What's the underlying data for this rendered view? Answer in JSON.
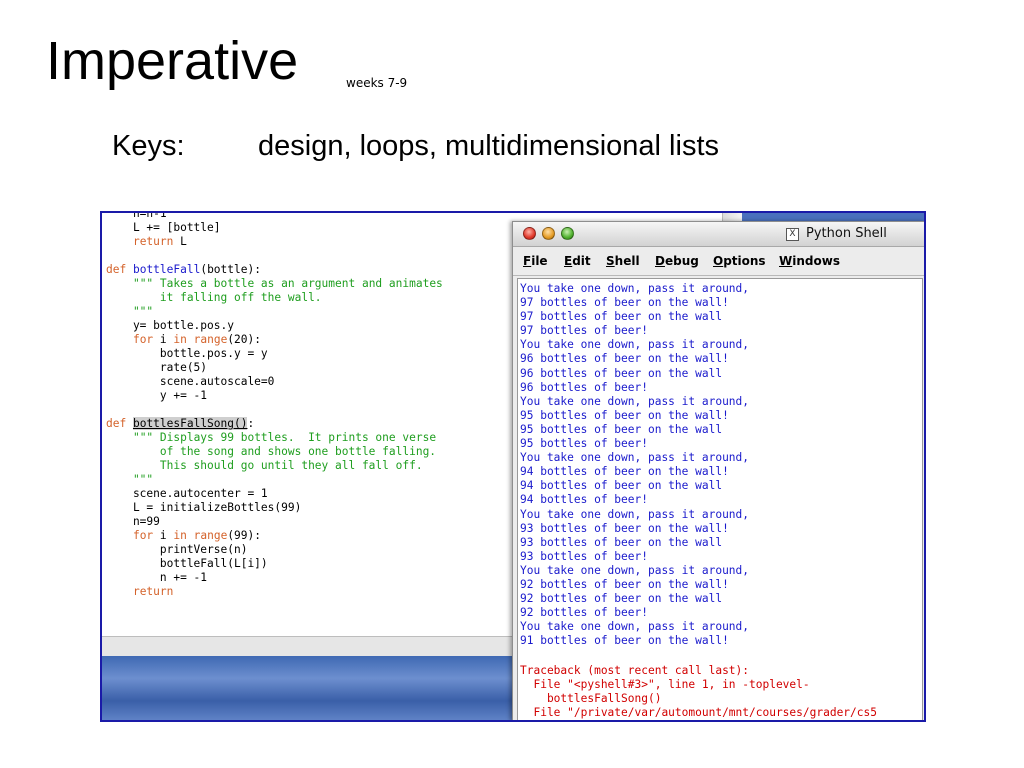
{
  "slide": {
    "title": "Imperative",
    "subtitle": "weeks 7-9",
    "keys_label": "Keys:",
    "keys_value": "design, loops, multidimensional lists"
  },
  "editor": {
    "code_lines": [
      [
        [
          "",
          "    n=n-1"
        ]
      ],
      [
        [
          "",
          "    L += [bottle]"
        ]
      ],
      [
        [
          "",
          "    "
        ],
        [
          "kw",
          "return"
        ],
        [
          "",
          " L"
        ]
      ],
      [
        [
          "",
          ""
        ]
      ],
      [
        [
          "kw",
          "def"
        ],
        [
          "",
          " "
        ],
        [
          "fn",
          "bottleFall"
        ],
        [
          "",
          "(bottle):"
        ]
      ],
      [
        [
          "",
          "    "
        ],
        [
          "str",
          "\"\"\" Takes a bottle as an argument and animates"
        ]
      ],
      [
        [
          "str",
          "        it falling off the wall."
        ]
      ],
      [
        [
          "str",
          "    \"\"\""
        ]
      ],
      [
        [
          "",
          "    y= bottle.pos.y"
        ]
      ],
      [
        [
          "",
          "    "
        ],
        [
          "kw",
          "for"
        ],
        [
          "",
          " i "
        ],
        [
          "kw",
          "in"
        ],
        [
          "",
          " "
        ],
        [
          "kw",
          "range"
        ],
        [
          "",
          "(20):"
        ]
      ],
      [
        [
          "",
          "        bottle.pos.y = y"
        ]
      ],
      [
        [
          "",
          "        rate(5)"
        ]
      ],
      [
        [
          "",
          "        scene.autoscale=0"
        ]
      ],
      [
        [
          "",
          "        y += -1"
        ]
      ],
      [
        [
          "",
          ""
        ]
      ],
      [
        [
          "kw",
          "def"
        ],
        [
          "",
          " "
        ],
        [
          "hl",
          "bottlesFallSong()"
        ],
        [
          "",
          ":"
        ]
      ],
      [
        [
          "",
          "    "
        ],
        [
          "str",
          "\"\"\" Displays 99 bottles.  It prints one verse"
        ]
      ],
      [
        [
          "str",
          "        of the song and shows one bottle falling."
        ]
      ],
      [
        [
          "str",
          "        This should go until they all fall off."
        ]
      ],
      [
        [
          "str",
          "    \"\"\""
        ]
      ],
      [
        [
          "",
          "    scene.autocenter = 1"
        ]
      ],
      [
        [
          "",
          "    L = initializeBottles(99)"
        ]
      ],
      [
        [
          "",
          "    n=99"
        ]
      ],
      [
        [
          "",
          "    "
        ],
        [
          "kw",
          "for"
        ],
        [
          "",
          " i "
        ],
        [
          "kw",
          "in"
        ],
        [
          "",
          " "
        ],
        [
          "kw",
          "range"
        ],
        [
          "",
          "(99):"
        ]
      ],
      [
        [
          "",
          "        printVerse(n)"
        ]
      ],
      [
        [
          "",
          "        bottleFall(L[i])"
        ]
      ],
      [
        [
          "",
          "        n += -1"
        ]
      ],
      [
        [
          "",
          "    "
        ],
        [
          "kw",
          "return"
        ]
      ]
    ]
  },
  "shell": {
    "window_title": "Python Shell",
    "menu": [
      "File",
      "Edit",
      "Shell",
      "Debug",
      "Options",
      "Windows"
    ],
    "output_lines": [
      "You take one down, pass it around,",
      "97 bottles of beer on the wall!",
      "97 bottles of beer on the wall",
      "97 bottles of beer!",
      "You take one down, pass it around,",
      "96 bottles of beer on the wall!",
      "96 bottles of beer on the wall",
      "96 bottles of beer!",
      "You take one down, pass it around,",
      "95 bottles of beer on the wall!",
      "95 bottles of beer on the wall",
      "95 bottles of beer!",
      "You take one down, pass it around,",
      "94 bottles of beer on the wall!",
      "94 bottles of beer on the wall",
      "94 bottles of beer!",
      "You take one down, pass it around,",
      "93 bottles of beer on the wall!",
      "93 bottles of beer on the wall",
      "93 bottles of beer!",
      "You take one down, pass it around,",
      "92 bottles of beer on the wall!",
      "92 bottles of beer on the wall",
      "92 bottles of beer!",
      "You take one down, pass it around,",
      "91 bottles of beer on the wall!"
    ],
    "error_lines": [
      "Traceback (most recent call last):",
      "  File \"<pyshell#3>\", line 1, in -toplevel-",
      "    bottlesFallSong()",
      "  File \"/private/var/automount/mnt/courses/grader/cs5"
    ]
  },
  "colors": {
    "keyword": "#d4622a",
    "function_name": "#1a1acc",
    "docstring": "#1f9e1f",
    "shell_output": "#1a1acc",
    "shell_error": "#d10000",
    "screenshot_border": "#1a1aa8"
  },
  "icons": {
    "close": "close-traffic-light-icon",
    "minimize": "minimize-traffic-light-icon",
    "zoom": "zoom-traffic-light-icon",
    "x11": "x11-icon"
  }
}
